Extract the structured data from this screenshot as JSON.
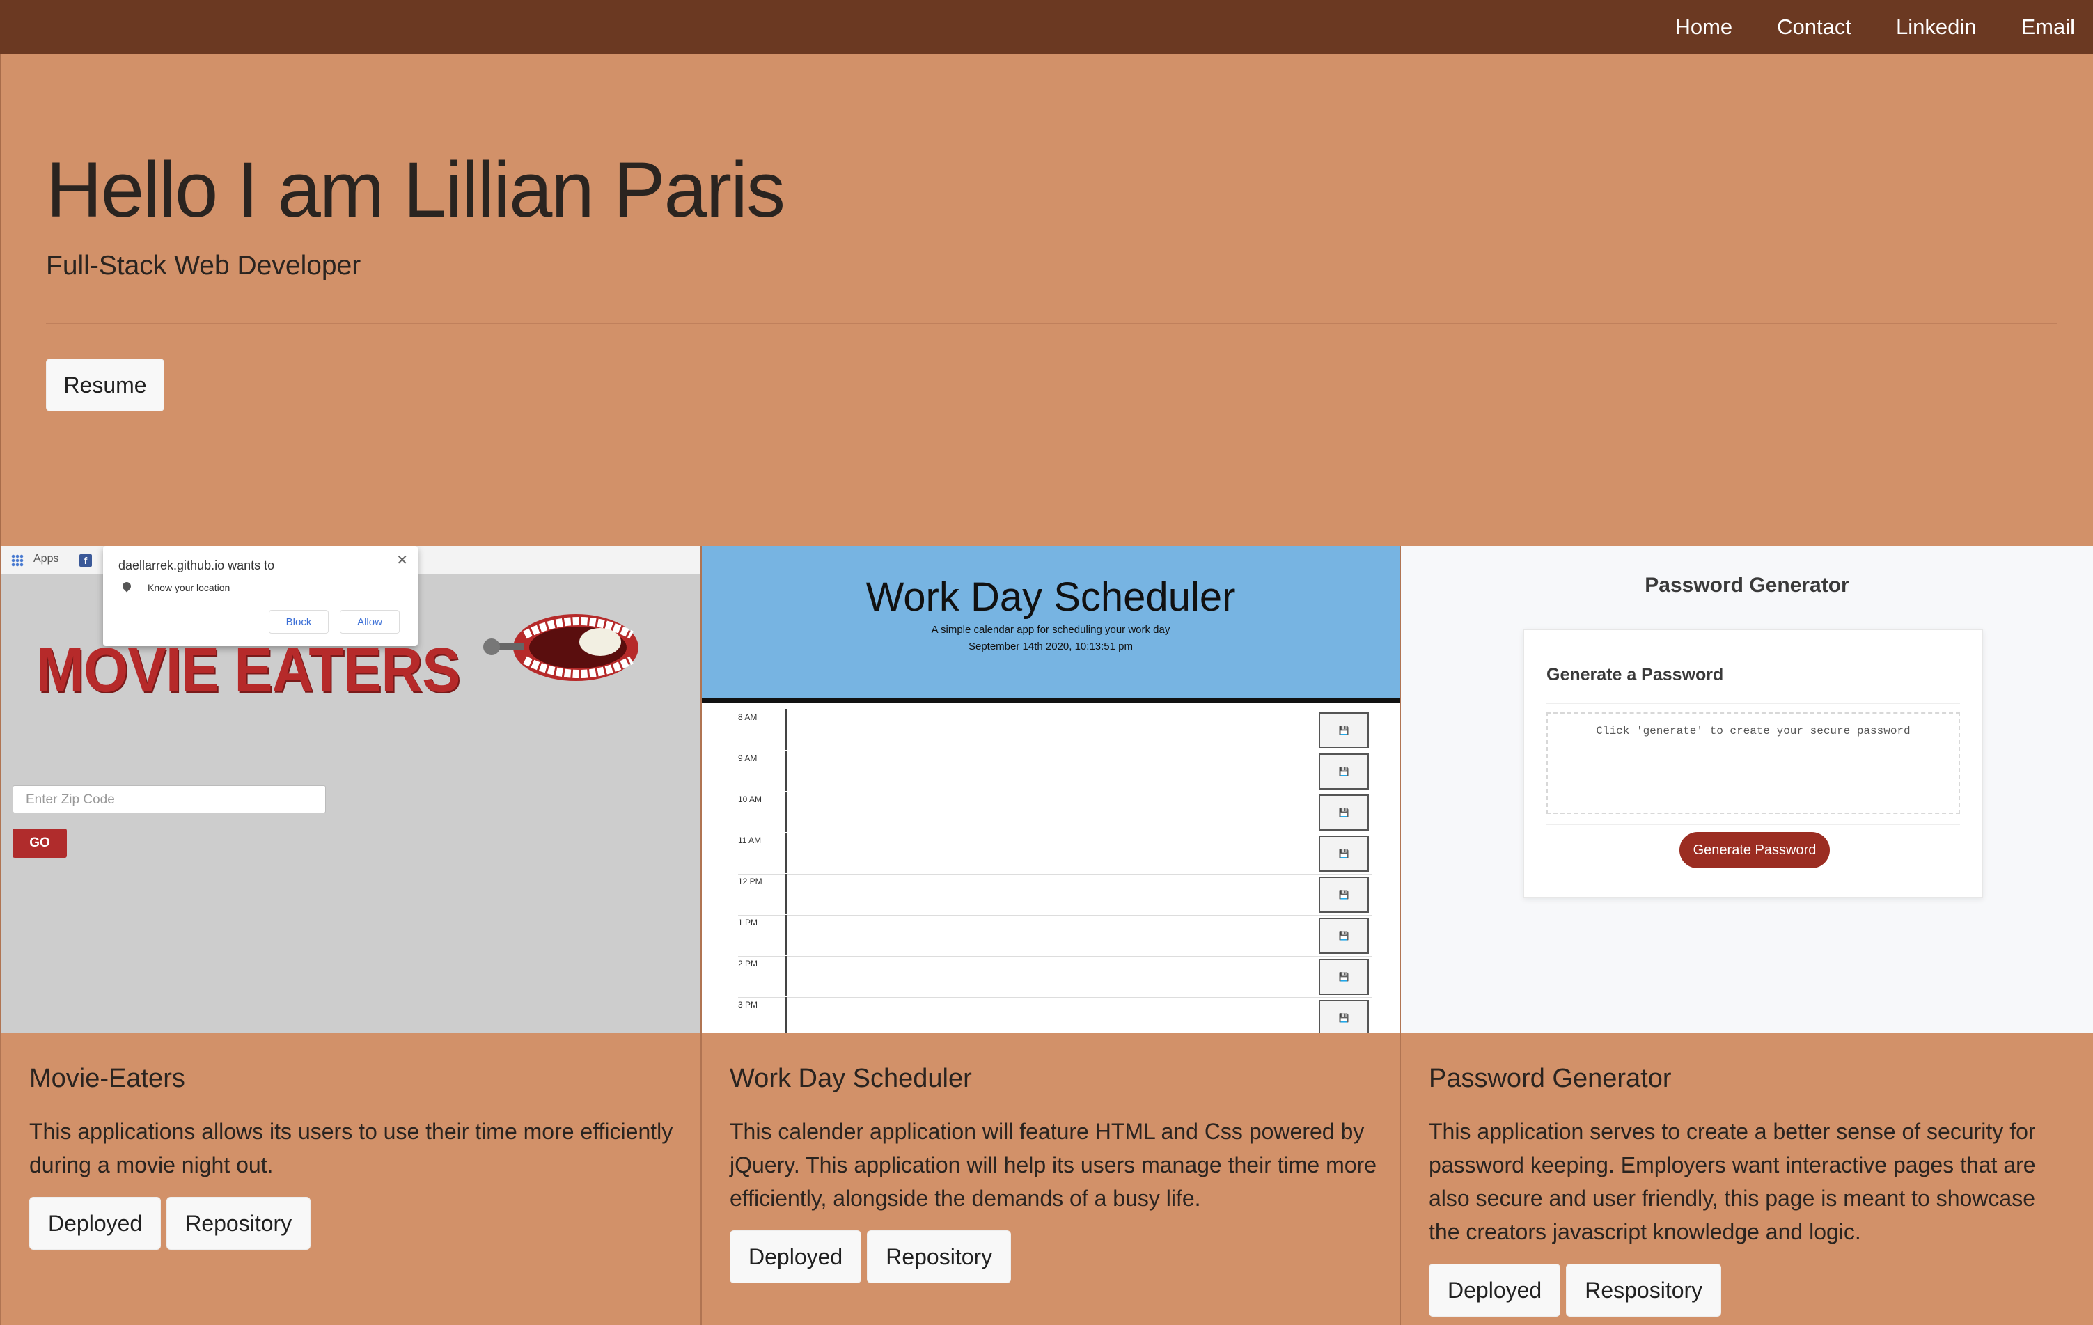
{
  "nav": {
    "links": [
      "Home",
      "Contact",
      "Linkedin",
      "Email"
    ]
  },
  "hero": {
    "title": "Hello I am Lillian Paris",
    "subtitle": "Full-Stack Web Developer",
    "resume_label": "Resume"
  },
  "projects": [
    {
      "title": "Movie-Eaters",
      "description": "This applications allows its users to use their time more efficiently during a movie night out.",
      "buttons": [
        "Deployed",
        "Repository"
      ],
      "preview": {
        "apps_label": "Apps",
        "popup_title": "daellarrek.github.io wants to",
        "popup_text": "Know your location",
        "block_label": "Block",
        "allow_label": "Allow",
        "logo_text": "MOVIE EATERS",
        "zip_placeholder": "Enter Zip Code",
        "go_label": "GO"
      }
    },
    {
      "title": "Work Day Scheduler",
      "description": "This calender application will feature HTML and Css powered by jQuery. This application will help its users manage their time more efficiently, alongside the demands of a busy life.",
      "buttons": [
        "Deployed",
        "Repository"
      ],
      "preview": {
        "title": "Work Day Scheduler",
        "subtitle": "A simple calendar app for scheduling your work day",
        "date": "September 14th 2020, 10:13:51 pm",
        "hours": [
          "8 AM",
          "9 AM",
          "10 AM",
          "11 AM",
          "12 PM",
          "1 PM",
          "2 PM",
          "3 PM"
        ]
      }
    },
    {
      "title": "Password Generator",
      "description": "This application serves to create a better sense of security for password keeping. Employers want interactive pages that are also secure and user friendly, this page is meant to showcase the creators javascript knowledge and logic.",
      "buttons": [
        "Deployed",
        "Respository"
      ],
      "preview": {
        "title": "Password Generator",
        "card_title": "Generate a Password",
        "placeholder": "Click 'generate' to create your secure password",
        "button_label": "Generate Password"
      }
    }
  ],
  "colors": {
    "navbar": "#6b3922",
    "background": "#d29169",
    "accent_red": "#b02c2c",
    "scheduler_blue": "#77b4e2"
  }
}
